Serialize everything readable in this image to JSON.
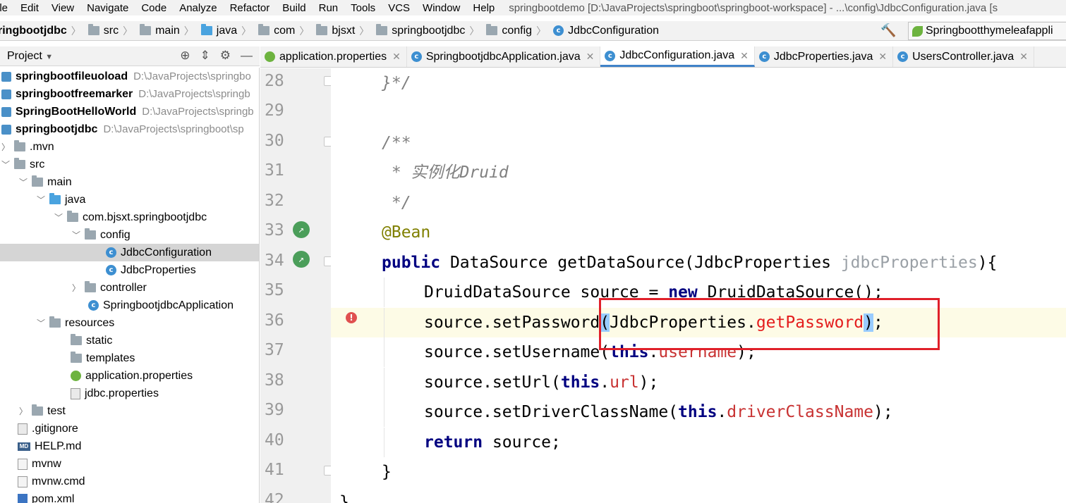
{
  "menubar": {
    "items": [
      "ile",
      "Edit",
      "View",
      "Navigate",
      "Code",
      "Analyze",
      "Refactor",
      "Build",
      "Run",
      "Tools",
      "VCS",
      "Window",
      "Help"
    ],
    "window_title": "springbootdemo [D:\\JavaProjects\\springboot\\springboot-workspace] - ...\\config\\JdbcConfiguration.java [s"
  },
  "navbar": {
    "crumbs": [
      "ringbootjdbc",
      "src",
      "main",
      "java",
      "com",
      "bjsxt",
      "springbootjdbc",
      "config",
      "JdbcConfiguration"
    ],
    "run_config": "Springbootthymeleafappli"
  },
  "project": {
    "title": "Project",
    "tree": [
      {
        "label": "springbootfileuoload",
        "path": "D:\\JavaProjects\\springbo",
        "bold": true
      },
      {
        "label": "springbootfreemarker",
        "path": "D:\\JavaProjects\\springb",
        "bold": true
      },
      {
        "label": "SpringBootHelloWorld",
        "path": "D:\\JavaProjects\\springb",
        "bold": true
      },
      {
        "label": "springbootjdbc",
        "path": "D:\\JavaProjects\\springboot\\sp",
        "bold": true
      },
      {
        "label": ".mvn"
      },
      {
        "label": "src"
      },
      {
        "label": "main"
      },
      {
        "label": "java"
      },
      {
        "label": "com.bjsxt.springbootjdbc"
      },
      {
        "label": "config"
      },
      {
        "label": "JdbcConfiguration"
      },
      {
        "label": "JdbcProperties"
      },
      {
        "label": "controller"
      },
      {
        "label": "SpringbootjdbcApplication"
      },
      {
        "label": "resources"
      },
      {
        "label": "static"
      },
      {
        "label": "templates"
      },
      {
        "label": "application.properties"
      },
      {
        "label": "jdbc.properties"
      },
      {
        "label": "test"
      },
      {
        "label": ".gitignore"
      },
      {
        "label": "HELP.md"
      },
      {
        "label": "mvnw"
      },
      {
        "label": "mvnw.cmd"
      },
      {
        "label": "pom.xml"
      }
    ]
  },
  "tabs": [
    "application.properties",
    "SpringbootjdbcApplication.java",
    "JdbcConfiguration.java",
    "JdbcProperties.java",
    "UsersController.java"
  ],
  "editor": {
    "line_numbers": [
      "28",
      "29",
      "30",
      "31",
      "32",
      "33",
      "34",
      "35",
      "36",
      "37",
      "38",
      "39",
      "40",
      "41",
      "42"
    ],
    "l28": "}*/",
    "l30": "/**",
    "l31": " * 实例化Druid",
    "l32": " */",
    "l33": "@Bean",
    "l34_kw": "public",
    "l34_a": " DataSource getDataSource(JdbcProperties ",
    "l34_param": "jdbcProperties",
    "l34_b": "){",
    "l35_a": "DruidDataSource source = ",
    "l35_kw": "new",
    "l35_b": " DruidDataSource();",
    "l36_a": "source.setPassword",
    "l36_p1": "(",
    "l36_b": "JdbcProperties.",
    "l36_err": "getPassword",
    "l36_p2": ")",
    "l36_c": ";",
    "l37_a": "source.setUsername(",
    "l37_kw": "this",
    "l37_dot": ".",
    "l37_f": "username",
    "l37_b": ");",
    "l38_a": "source.setUrl(",
    "l38_kw": "this",
    "l38_dot": ".",
    "l38_f": "url",
    "l38_b": ");",
    "l39_a": "source.setDriverClassName(",
    "l39_kw": "this",
    "l39_dot": ".",
    "l39_f": "driverClassName",
    "l39_b": ");",
    "l40_kw": "return",
    "l40_b": " source;",
    "l41": "}",
    "l42": "}"
  }
}
